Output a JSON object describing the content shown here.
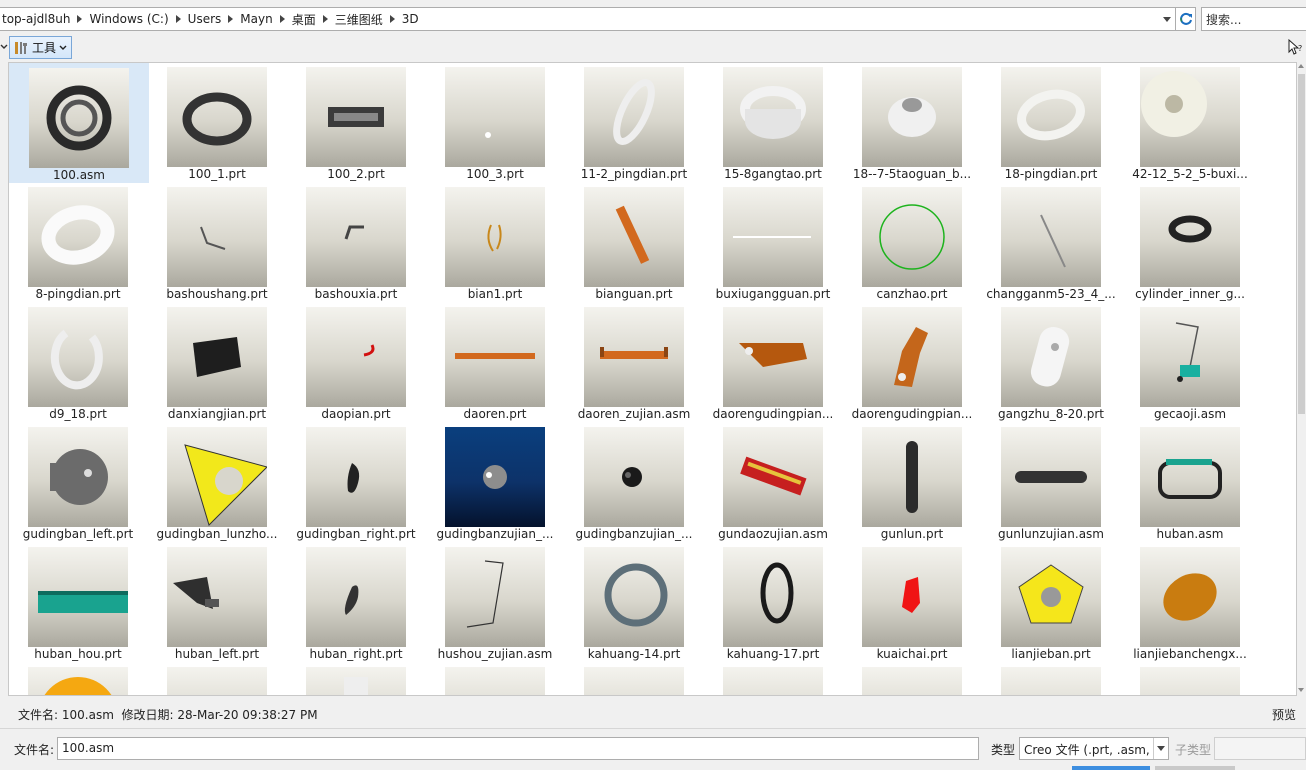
{
  "address": {
    "crumbs": [
      "top-ajdl8uh",
      "Windows (C:)",
      "Users",
      "Mayn",
      "桌面",
      "三维图纸",
      "3D"
    ],
    "search_placeholder": "搜索..."
  },
  "toolbar": {
    "tools_label": "工具"
  },
  "files": [
    {
      "name": "100.asm",
      "selected": true
    },
    {
      "name": "100_1.prt"
    },
    {
      "name": "100_2.prt"
    },
    {
      "name": "100_3.prt"
    },
    {
      "name": "11-2_pingdian.prt"
    },
    {
      "name": "15-8gangtao.prt"
    },
    {
      "name": "18--7-5taoguan_b..."
    },
    {
      "name": "18-pingdian.prt"
    },
    {
      "name": "42-12_5-2_5-buxi..."
    },
    {
      "name": "8-pingdian.prt"
    },
    {
      "name": "bashoushang.prt"
    },
    {
      "name": "bashouxia.prt"
    },
    {
      "name": "bian1.prt"
    },
    {
      "name": "bianguan.prt"
    },
    {
      "name": "buxiugangguan.prt"
    },
    {
      "name": "canzhao.prt"
    },
    {
      "name": "changganm5-23_4_..."
    },
    {
      "name": "cylinder_inner_g..."
    },
    {
      "name": "d9_18.prt"
    },
    {
      "name": "danxiangjian.prt"
    },
    {
      "name": "daopian.prt"
    },
    {
      "name": "daoren.prt"
    },
    {
      "name": "daoren_zujian.asm"
    },
    {
      "name": "daorengudingpian..."
    },
    {
      "name": "daorengudingpian..."
    },
    {
      "name": "gangzhu_8-20.prt"
    },
    {
      "name": "gecaoji.asm"
    },
    {
      "name": "gudingban_left.prt"
    },
    {
      "name": "gudingban_lunzho..."
    },
    {
      "name": "gudingban_right.prt"
    },
    {
      "name": "gudingbanzujian_..."
    },
    {
      "name": "gudingbanzujian_..."
    },
    {
      "name": "gundaozujian.asm"
    },
    {
      "name": "gunlun.prt"
    },
    {
      "name": "gunlunzujian.asm"
    },
    {
      "name": "huban.asm"
    },
    {
      "name": "huban_hou.prt"
    },
    {
      "name": "huban_left.prt"
    },
    {
      "name": "huban_right.prt"
    },
    {
      "name": "hushou_zujian.asm"
    },
    {
      "name": "kahuang-14.prt"
    },
    {
      "name": "kahuang-17.prt"
    },
    {
      "name": "kuaichai.prt"
    },
    {
      "name": "lianjieban.prt"
    },
    {
      "name": "lianjiebanchengx..."
    },
    {
      "name": ""
    },
    {
      "name": ""
    },
    {
      "name": ""
    },
    {
      "name": ""
    },
    {
      "name": ""
    },
    {
      "name": ""
    },
    {
      "name": ""
    },
    {
      "name": ""
    },
    {
      "name": ""
    }
  ],
  "info": {
    "filename_label": "文件名:",
    "filename_value": "100.asm",
    "modified_label": "修改日期:",
    "modified_value": "28-Mar-20 09:38:27 PM",
    "preview_label": "预览"
  },
  "bottom": {
    "filename_label": "文件名:",
    "filename_value": "100.asm",
    "type_label": "类型",
    "type_value": "Creo 文件 (.prt, .asm,",
    "subtype_label": "子类型"
  },
  "colors": {
    "selection": "#d9e8f7",
    "accent": "#3d8ee0"
  }
}
